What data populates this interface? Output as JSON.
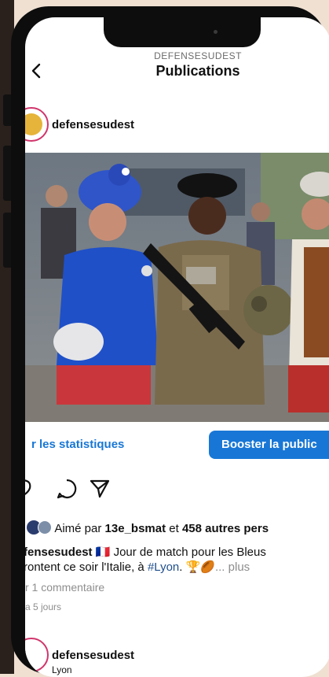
{
  "header": {
    "account": "DEFENSESUDEST",
    "title": "Publications"
  },
  "post": {
    "username": "defensesudest",
    "stats_link": "r les statistiques",
    "boost_button": "Booster la public",
    "likes": {
      "prefix": "Aimé par",
      "first_user": "13e_bsmat",
      "connector": "et",
      "count_text": "458 autres pers"
    },
    "caption": {
      "author": "fensesudest",
      "flag": "🇫🇷",
      "line1": "Jour de match pour les Bleus",
      "line2_start": "rontent ce soir l'Italie, à",
      "hashtag": "#Lyon",
      "line2_end": ".",
      "emojis": "🏆🏉",
      "more": "... plus"
    },
    "comments_link": "r 1 commentaire",
    "time": "a 5 jours"
  },
  "next_post": {
    "username": "defensesudest",
    "location": "Lyon"
  },
  "icons": {
    "back": "chevron-left-icon",
    "comment": "comment-icon",
    "share": "paper-plane-icon",
    "like": "heart-icon"
  },
  "colors": {
    "accent": "#1877d6",
    "background": "#efe0d2",
    "phone": "#0d0d0d"
  }
}
